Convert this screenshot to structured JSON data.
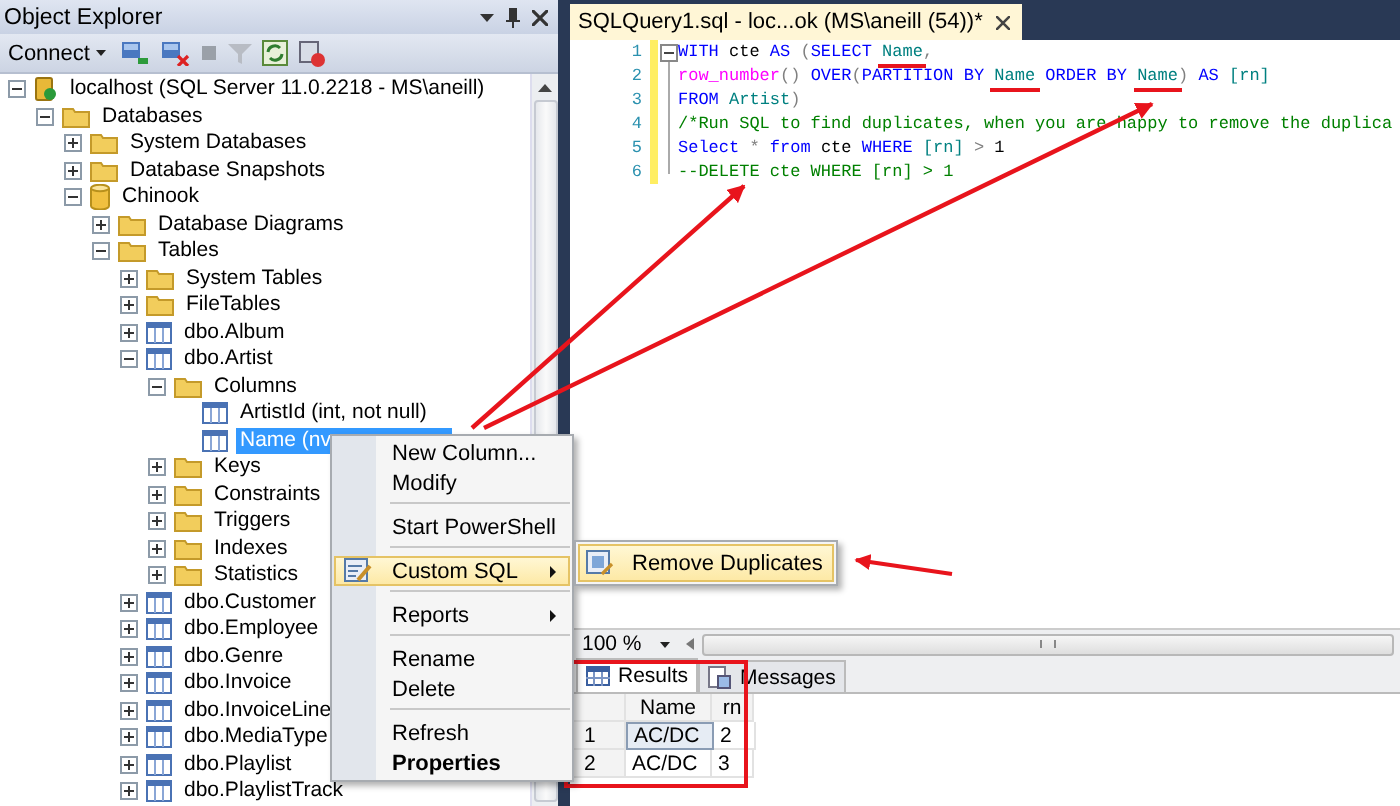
{
  "explorer": {
    "title": "Object Explorer",
    "connect": "Connect"
  },
  "tree": [
    {
      "label": "localhost (SQL Server 11.0.2218 - MS\\aneill)",
      "kind": "server",
      "expanded": true,
      "selected": false,
      "children": [
        {
          "label": "Databases",
          "kind": "folder",
          "expanded": true,
          "selected": false,
          "children": [
            {
              "label": "System Databases",
              "kind": "folder",
              "expanded": false,
              "selected": false
            },
            {
              "label": "Database Snapshots",
              "kind": "folder",
              "expanded": false,
              "selected": false
            },
            {
              "label": "Chinook",
              "kind": "database",
              "expanded": true,
              "selected": false,
              "children": [
                {
                  "label": "Database Diagrams",
                  "kind": "folder",
                  "expanded": false,
                  "selected": false
                },
                {
                  "label": "Tables",
                  "kind": "folder",
                  "expanded": true,
                  "selected": false,
                  "children": [
                    {
                      "label": "System Tables",
                      "kind": "folder",
                      "expanded": false,
                      "selected": false
                    },
                    {
                      "label": "FileTables",
                      "kind": "folder",
                      "expanded": false,
                      "selected": false
                    },
                    {
                      "label": "dbo.Album",
                      "kind": "table",
                      "expanded": false,
                      "selected": false
                    },
                    {
                      "label": "dbo.Artist",
                      "kind": "table",
                      "expanded": true,
                      "selected": false,
                      "children": [
                        {
                          "label": "Columns",
                          "kind": "folder",
                          "expanded": true,
                          "selected": false,
                          "children": [
                            {
                              "label": "ArtistId (int, not null)",
                              "kind": "column",
                              "selected": false
                            },
                            {
                              "label": "Name (nv",
                              "kind": "column",
                              "selected": true
                            }
                          ]
                        },
                        {
                          "label": "Keys",
                          "kind": "folder",
                          "expanded": false,
                          "selected": false
                        },
                        {
                          "label": "Constraints",
                          "kind": "folder",
                          "expanded": false,
                          "selected": false
                        },
                        {
                          "label": "Triggers",
                          "kind": "folder",
                          "expanded": false,
                          "selected": false
                        },
                        {
                          "label": "Indexes",
                          "kind": "folder",
                          "expanded": false,
                          "selected": false
                        },
                        {
                          "label": "Statistics",
                          "kind": "folder",
                          "expanded": false,
                          "selected": false
                        }
                      ]
                    },
                    {
                      "label": "dbo.Customer",
                      "kind": "table",
                      "expanded": false,
                      "selected": false
                    },
                    {
                      "label": "dbo.Employee",
                      "kind": "table",
                      "expanded": false,
                      "selected": false
                    },
                    {
                      "label": "dbo.Genre",
                      "kind": "table",
                      "expanded": false,
                      "selected": false
                    },
                    {
                      "label": "dbo.Invoice",
                      "kind": "table",
                      "expanded": false,
                      "selected": false
                    },
                    {
                      "label": "dbo.InvoiceLine",
                      "kind": "table",
                      "expanded": false,
                      "selected": false
                    },
                    {
                      "label": "dbo.MediaType",
                      "kind": "table",
                      "expanded": false,
                      "selected": false
                    },
                    {
                      "label": "dbo.Playlist",
                      "kind": "table",
                      "expanded": false,
                      "selected": false
                    },
                    {
                      "label": "dbo.PlaylistTrack",
                      "kind": "table",
                      "expanded": false,
                      "selected": false
                    }
                  ]
                }
              ]
            }
          ]
        }
      ]
    }
  ],
  "editor": {
    "tab": "SQLQuery1.sql - loc...ok (MS\\aneill (54))*",
    "lines": [
      {
        "number": "1",
        "tokens": [
          {
            "text": "WITH ",
            "kind": "keyword"
          },
          {
            "text": "cte ",
            "kind": "plain"
          },
          {
            "text": "AS",
            "kind": "keyword"
          },
          {
            "text": " (",
            "kind": "operator"
          },
          {
            "text": "SELECT ",
            "kind": "keyword"
          },
          {
            "text": "Name",
            "kind": "identifier",
            "underlined": true
          },
          {
            "text": ",",
            "kind": "operator"
          }
        ]
      },
      {
        "number": "2",
        "tokens": [
          {
            "text": "row_number",
            "kind": "function"
          },
          {
            "text": "() ",
            "kind": "operator"
          },
          {
            "text": "OVER",
            "kind": "keyword"
          },
          {
            "text": "(",
            "kind": "operator"
          },
          {
            "text": "PARTITION BY ",
            "kind": "keyword"
          },
          {
            "text": "Name",
            "kind": "identifier",
            "underlined": true
          },
          {
            "text": " ORDER BY ",
            "kind": "keyword"
          },
          {
            "text": "Name",
            "kind": "identifier",
            "underlined": true
          },
          {
            "text": ") ",
            "kind": "operator"
          },
          {
            "text": "AS ",
            "kind": "keyword"
          },
          {
            "text": "[rn]",
            "kind": "identifier"
          }
        ]
      },
      {
        "number": "3",
        "tokens": [
          {
            "text": "FROM ",
            "kind": "keyword"
          },
          {
            "text": "Artist",
            "kind": "identifier"
          },
          {
            "text": ")",
            "kind": "operator"
          }
        ]
      },
      {
        "number": "4",
        "tokens": [
          {
            "text": "/*Run SQL to find duplicates, when you are happy to remove the duplica",
            "kind": "comment"
          }
        ]
      },
      {
        "number": "5",
        "tokens": [
          {
            "text": "Select ",
            "kind": "keyword"
          },
          {
            "text": "* ",
            "kind": "operator"
          },
          {
            "text": "from ",
            "kind": "keyword"
          },
          {
            "text": "cte ",
            "kind": "plain"
          },
          {
            "text": "WHERE ",
            "kind": "keyword"
          },
          {
            "text": "[rn] ",
            "kind": "identifier"
          },
          {
            "text": "> ",
            "kind": "operator"
          },
          {
            "text": "1",
            "kind": "plain"
          }
        ]
      },
      {
        "number": "6",
        "tokens": [
          {
            "text": "--DELETE cte WHERE [rn] > 1",
            "kind": "comment"
          }
        ]
      }
    ]
  },
  "context_menu": [
    {
      "kind": "item",
      "label": "New Column...",
      "selected": false
    },
    {
      "kind": "item",
      "label": "Modify",
      "selected": false
    },
    {
      "kind": "separator"
    },
    {
      "kind": "item",
      "label": "Start PowerShell",
      "selected": false
    },
    {
      "kind": "separator"
    },
    {
      "kind": "submenu",
      "label": "Custom SQL",
      "selected": true,
      "has_icon": true
    },
    {
      "kind": "separator"
    },
    {
      "kind": "submenu",
      "label": "Reports",
      "selected": false
    },
    {
      "kind": "separator"
    },
    {
      "kind": "item",
      "label": "Rename",
      "selected": false
    },
    {
      "kind": "item",
      "label": "Delete",
      "selected": false
    },
    {
      "kind": "separator"
    },
    {
      "kind": "item",
      "label": "Refresh",
      "selected": false
    },
    {
      "kind": "item",
      "label": "Properties",
      "selected": false,
      "default": true
    }
  ],
  "submenu": [
    {
      "label": "Remove Duplicates",
      "selected": true
    }
  ],
  "results": {
    "zoom": "100 %",
    "tabs": [
      {
        "label": "Results",
        "selected": true
      },
      {
        "label": "Messages",
        "selected": false
      }
    ],
    "columns": [
      "Name",
      "rn"
    ],
    "rows": [
      {
        "number": "1",
        "cells": [
          {
            "text": "AC/DC",
            "selected": true
          },
          {
            "text": "2",
            "selected": false
          }
        ]
      },
      {
        "number": "2",
        "cells": [
          {
            "text": "AC/DC",
            "selected": false
          },
          {
            "text": "3",
            "selected": false
          }
        ]
      }
    ]
  }
}
